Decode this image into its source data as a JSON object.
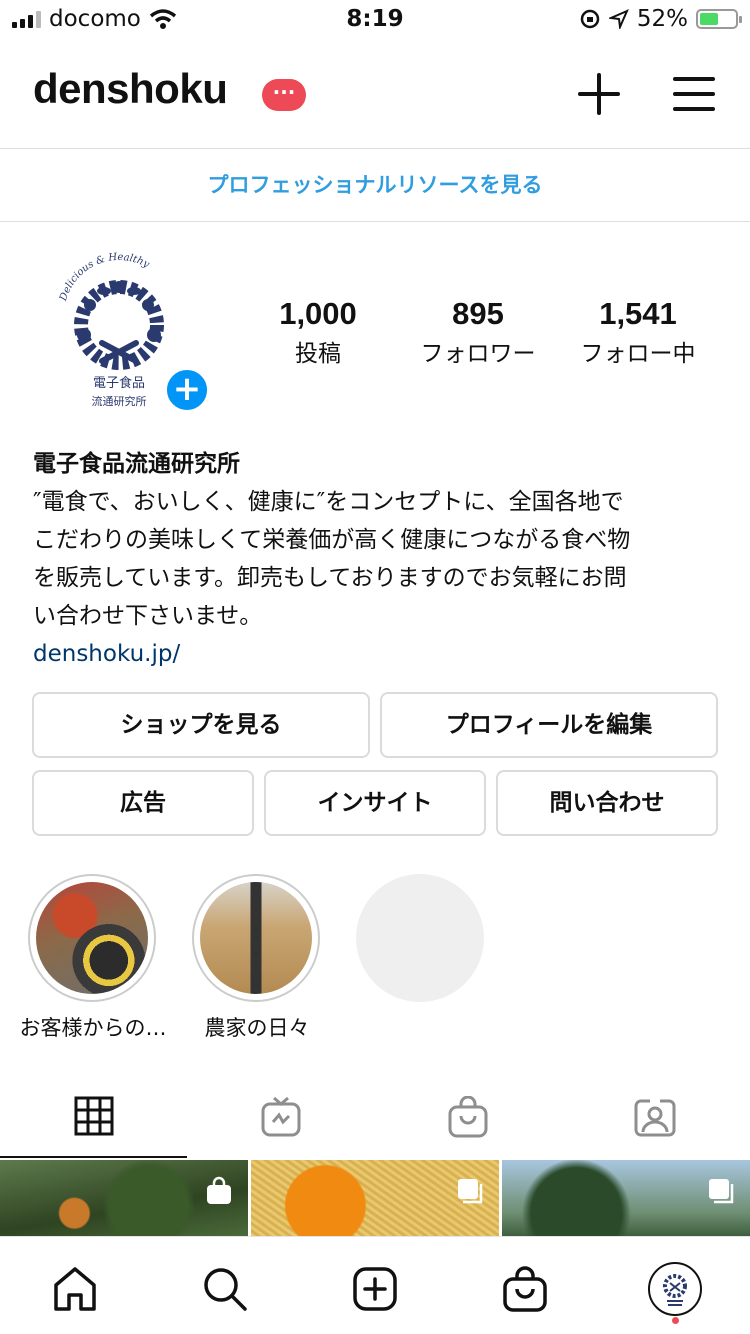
{
  "status": {
    "carrier": "docomo",
    "time": "8:19",
    "battery_percent": "52%",
    "battery_level": 0.52
  },
  "header": {
    "username": "denshoku",
    "badge": "···"
  },
  "pro_link": "プロフェッショナルリソースを見る",
  "avatar_logo": {
    "top_text": "Delicious & Healthy",
    "line1": "電子食品",
    "line2": "流通研究所"
  },
  "stats": [
    {
      "value": "1,000",
      "label": "投稿"
    },
    {
      "value": "895",
      "label": "フォロワー"
    },
    {
      "value": "1,541",
      "label": "フォロー中"
    }
  ],
  "bio": {
    "name": "電子食品流通研究所",
    "lines": [
      "″電食で、おいしく、健康に″をコンセプトに、全国各地で",
      "こだわりの美味しくて栄養価が高く健康につながる食べ物",
      "を販売しています。卸売もしておりますのでお気軽にお問",
      "い合わせ下さいませ。"
    ],
    "link": "denshoku.jp/"
  },
  "buttons": {
    "shop": "ショップを見る",
    "edit_profile": "プロフィールを編集",
    "ads": "広告",
    "insights": "インサイト",
    "contact": "問い合わせ"
  },
  "highlights": [
    {
      "caption": "お客様からの…"
    },
    {
      "caption": "農家の日々"
    }
  ],
  "tabs": [
    "grid-icon",
    "igtv-icon",
    "shop-bag-icon",
    "tagged-icon"
  ],
  "bottom_nav": [
    "home-icon",
    "search-icon",
    "new-post-icon",
    "shop-icon",
    "profile-avatar"
  ],
  "colors": {
    "accent_blue": "#0095f6",
    "link_blue": "#2f9de0",
    "badge_red": "#ed4956"
  }
}
